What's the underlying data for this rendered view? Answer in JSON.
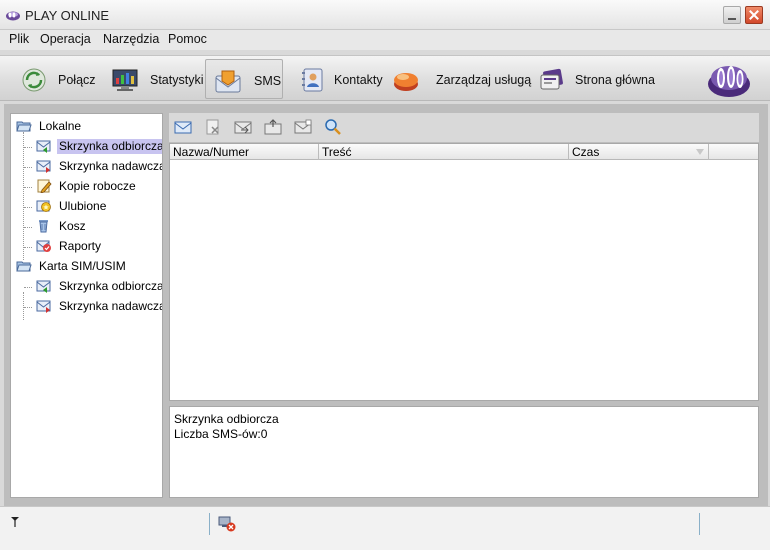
{
  "window": {
    "title": "PLAY ONLINE",
    "close_color": "#d2482a"
  },
  "menu": [
    "Plik",
    "Operacja",
    "Narzędzia",
    "Pomoc"
  ],
  "toolbar": {
    "buttons": [
      {
        "label": "Połącz",
        "icon": "connect-icon"
      },
      {
        "label": "Statystyki",
        "icon": "statistics-icon"
      },
      {
        "label": "SMS",
        "icon": "sms-icon",
        "active": true
      },
      {
        "label": "Kontakty",
        "icon": "contacts-icon"
      },
      {
        "label": "Zarządzaj usługą",
        "icon": "manage-service-icon"
      },
      {
        "label": "Strona główna",
        "icon": "home-page-icon"
      }
    ]
  },
  "tree": {
    "groups": [
      {
        "label": "Lokalne",
        "items": [
          "Skrzynka odbiorcza",
          "Skrzynka nadawcza",
          "Kopie robocze",
          "Ulubione",
          "Kosz",
          "Raporty"
        ]
      },
      {
        "label": "Karta SIM/USIM",
        "items": [
          "Skrzynka odbiorcza",
          "Skrzynka nadawcza"
        ]
      }
    ],
    "selected": "Skrzynka odbiorcza"
  },
  "list": {
    "columns": [
      "Nazwa/Numer",
      "Treść",
      "Czas"
    ],
    "rows": []
  },
  "info": {
    "folder_name": "Skrzynka odbiorcza",
    "count_text": "Liczba SMS-ów:0"
  },
  "colors": {
    "selection": "#c8c4f0",
    "accent_purple": "#5a3a8a"
  }
}
